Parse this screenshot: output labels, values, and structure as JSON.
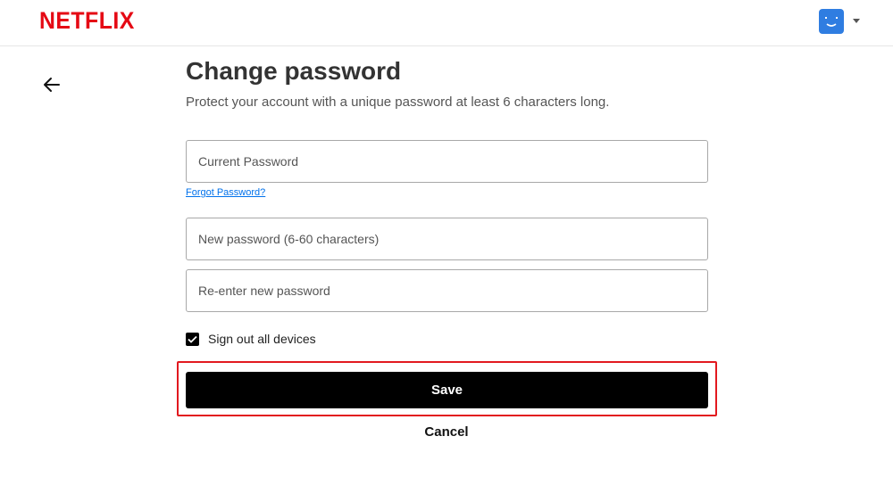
{
  "header": {
    "logo_text": "NETFLIX",
    "brand_color": "#e50914",
    "avatar_color": "#2f7de1",
    "avatar_icon": "smiley-face-icon",
    "menu_icon": "caret-down-icon"
  },
  "nav": {
    "back_icon": "arrow-left-icon"
  },
  "main": {
    "title": "Change password",
    "subtitle": "Protect your account with a unique password at least 6 characters long.",
    "current_password": {
      "placeholder": "Current Password",
      "value": ""
    },
    "forgot_link": "Forgot Password?",
    "new_password": {
      "placeholder": "New password (6-60 characters)",
      "value": ""
    },
    "reenter_password": {
      "placeholder": "Re-enter new password",
      "value": ""
    },
    "signout_label": "Sign out all devices",
    "signout_checked": true,
    "save_label": "Save",
    "cancel_label": "Cancel",
    "highlight_color": "#e2191f"
  }
}
